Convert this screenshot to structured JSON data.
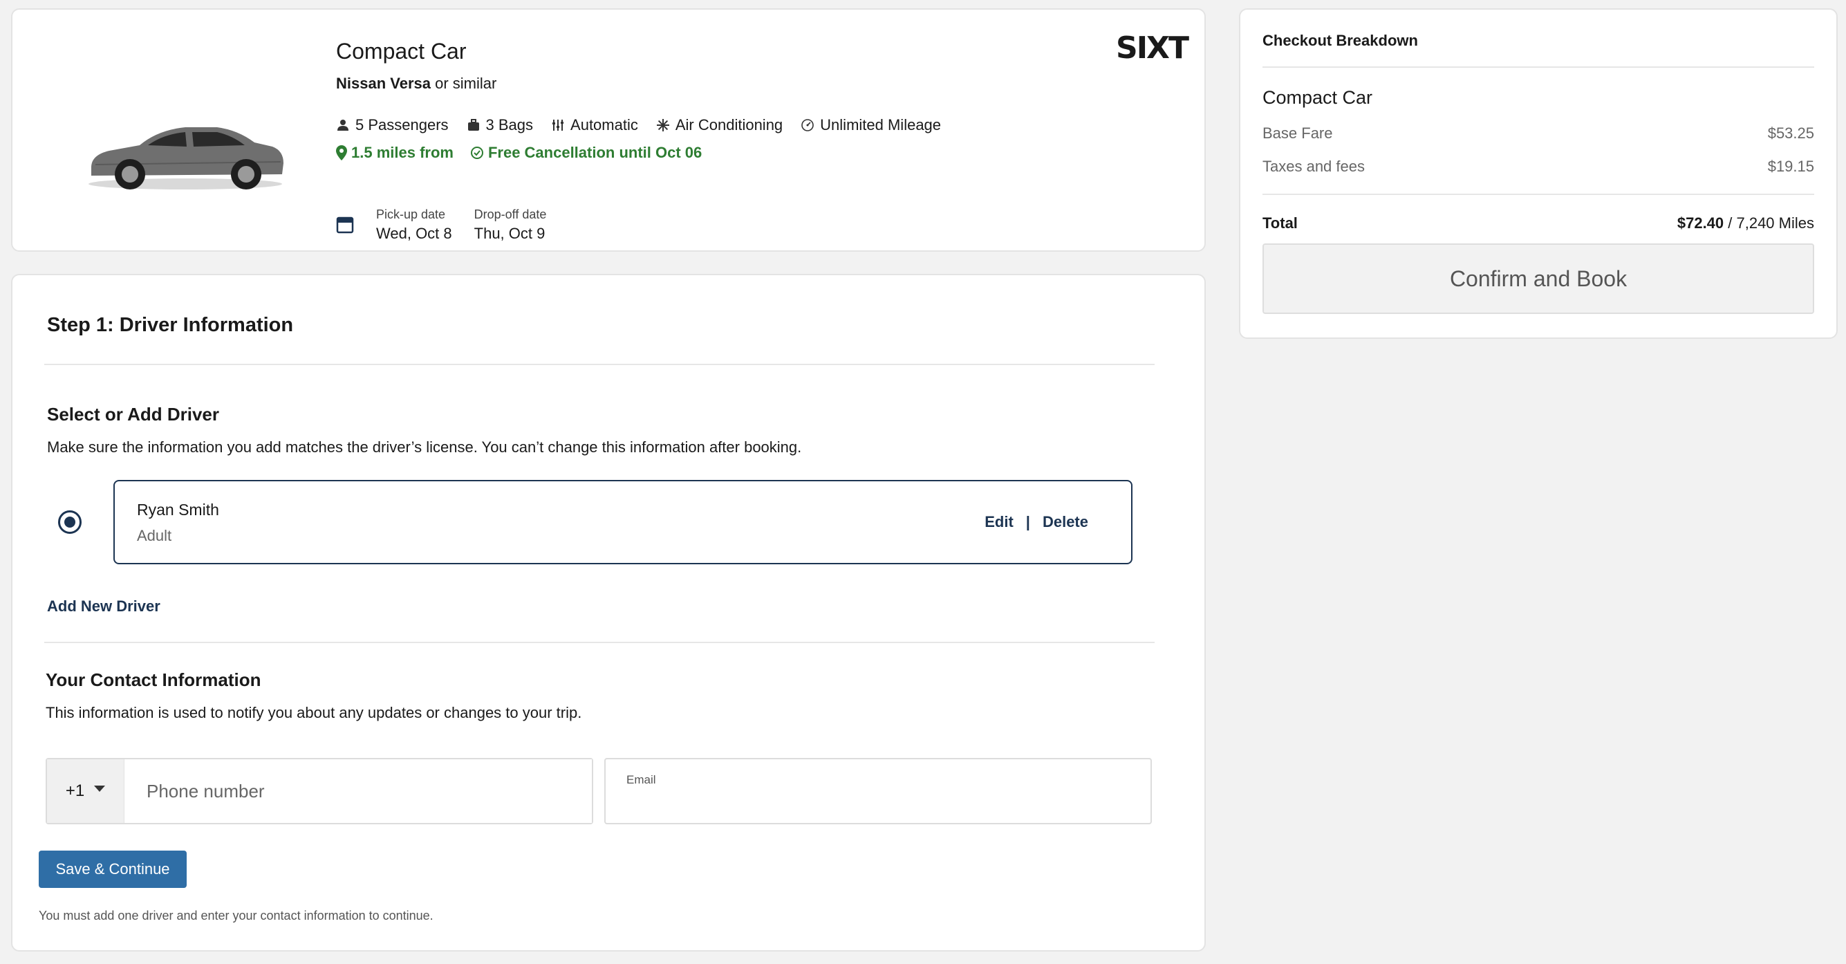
{
  "car": {
    "title": "Compact Car",
    "model": "Nissan Versa",
    "model_suffix": " or similar",
    "brand_logo": "SIXT",
    "features": {
      "passengers": "5 Passengers",
      "bags": "3 Bags",
      "transmission": "Automatic",
      "ac": "Air Conditioning",
      "mileage": "Unlimited Mileage"
    },
    "distance": "1.5 miles from",
    "cancellation": "Free Cancellation until Oct 06",
    "pickup_label": "Pick-up date",
    "pickup_value": "Wed, Oct 8",
    "dropoff_label": "Drop-off date",
    "dropoff_value": "Thu, Oct 9",
    "green_color": "#2e7d32"
  },
  "step": {
    "title": "Step 1: Driver Information",
    "select_title": "Select or Add Driver",
    "select_desc": "Make sure the information you add matches the driver’s license. You can’t change this information after booking.",
    "driver": {
      "name": "Ryan Smith",
      "type": "Adult",
      "edit_label": "Edit",
      "separator": "|",
      "delete_label": "Delete",
      "selected": true
    },
    "add_driver_label": "Add New Driver",
    "contact_title": "Your Contact Information",
    "contact_desc": "This information is used to notify you about any updates or changes to your trip.",
    "country_code": "+1",
    "phone_placeholder": "Phone number",
    "email_label": "Email",
    "email_value": "",
    "save_label": "Save & Continue",
    "footnote": "You must add one driver and enter your contact information to continue."
  },
  "checkout": {
    "title": "Checkout Breakdown",
    "car": "Compact Car",
    "base_fare_label": "Base Fare",
    "base_fare_value": "$53.25",
    "taxes_label": "Taxes and fees",
    "taxes_value": "$19.15",
    "total_label": "Total",
    "total_value": "$72.40",
    "total_suffix": " / 7,240 Miles",
    "confirm_label": "Confirm and Book"
  },
  "colors": {
    "accent_navy": "#1c3452",
    "button_blue": "#2f6ea6"
  }
}
